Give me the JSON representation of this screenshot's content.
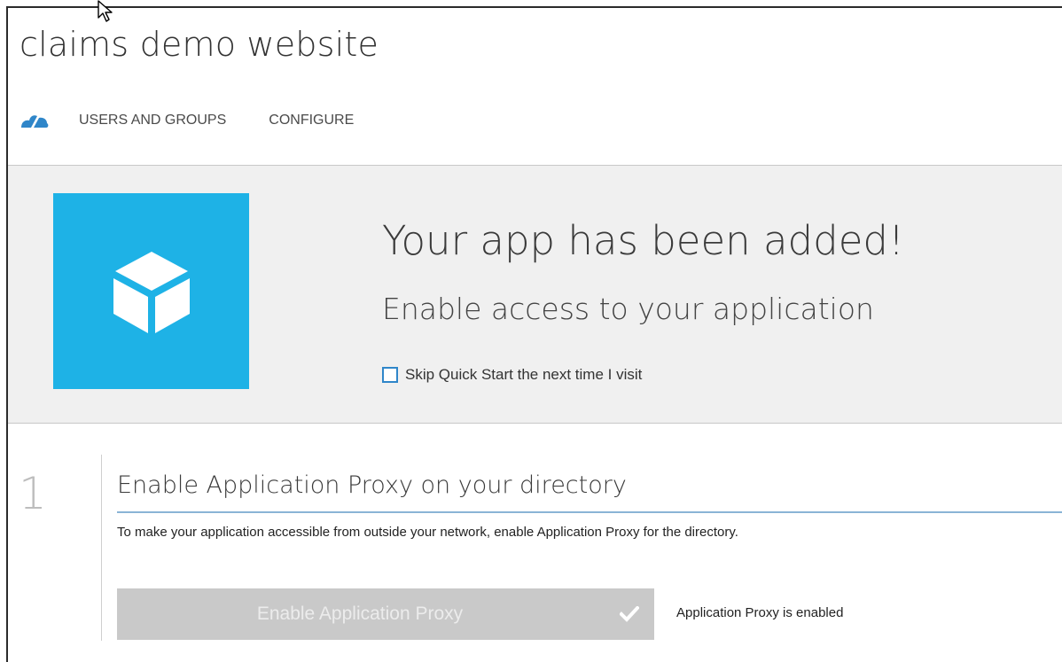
{
  "app": {
    "title": "claims demo website"
  },
  "nav": {
    "icon": "quickstart-cloud-icon",
    "items": [
      {
        "label": "USERS AND GROUPS"
      },
      {
        "label": "CONFIGURE"
      }
    ]
  },
  "hero": {
    "tile_icon": "cube-icon",
    "title": "Your app has been added!",
    "subtitle": "Enable access to your application",
    "skip_checkbox": {
      "label": "Skip Quick Start the next time I visit",
      "checked": false
    }
  },
  "step1": {
    "number": "1",
    "title": "Enable Application Proxy on your directory",
    "description": "To make your application accessible from outside your network, enable Application Proxy for the directory.",
    "button_label": "Enable Application Proxy",
    "button_state": "disabled",
    "button_icon": "checkmark-icon",
    "status": "Application Proxy is enabled"
  },
  "colors": {
    "tile": "#1eb2e6",
    "accent": "#2f86c9",
    "hero_background": "#f0f0f0",
    "button_disabled": "#c9c9c9"
  }
}
